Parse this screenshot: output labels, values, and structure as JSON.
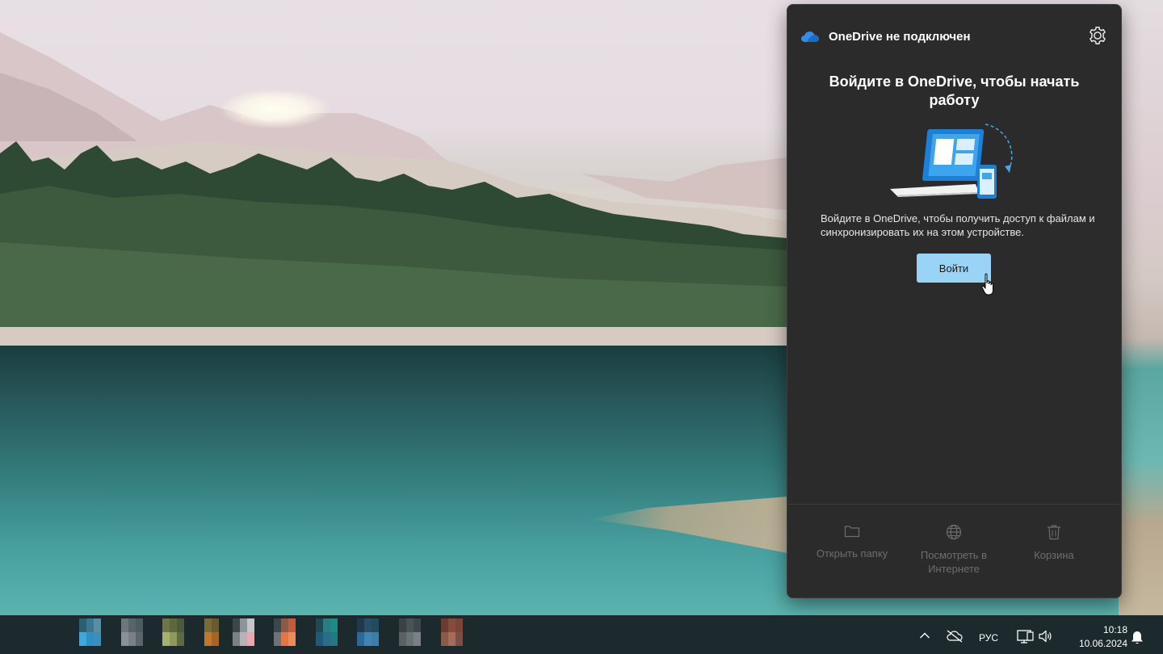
{
  "flyout": {
    "title": "OneDrive не подключен",
    "headline": "Войдите в OneDrive, чтобы начать работу",
    "description": "Войдите в OneDrive, чтобы получить доступ к файлам и синхронизировать их на этом устройстве.",
    "signin_label": "Войти",
    "footer": {
      "open_folder": "Открыть папку",
      "view_online": "Посмотреть в Интернете",
      "recycle_bin": "Корзина"
    },
    "accent_color": "#99d3f5"
  },
  "taskbar": {
    "language": "РУС",
    "time": "10:18",
    "date": "10.06.2024",
    "tray_icons": [
      "chevron-up-icon",
      "onedrive-offline-icon",
      "network-icon",
      "volume-icon",
      "bell-icon"
    ]
  }
}
